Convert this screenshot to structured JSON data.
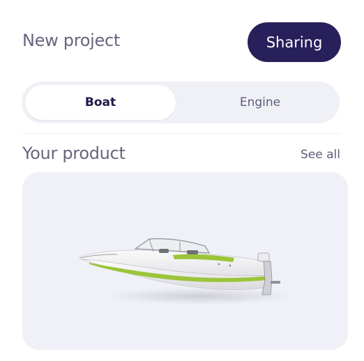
{
  "header": {
    "title": "New project",
    "sharing_label": "Sharing"
  },
  "tabs": [
    {
      "label": "Boat",
      "active": true
    },
    {
      "label": "Engine",
      "active": false
    }
  ],
  "section": {
    "title": "Your product",
    "see_all_label": "See all"
  },
  "product": {
    "image": "speedboat",
    "accent_color": "#9cc43a"
  },
  "colors": {
    "primary": "#28205a",
    "muted_text": "#66657f",
    "surface": "#f0f0f8"
  }
}
